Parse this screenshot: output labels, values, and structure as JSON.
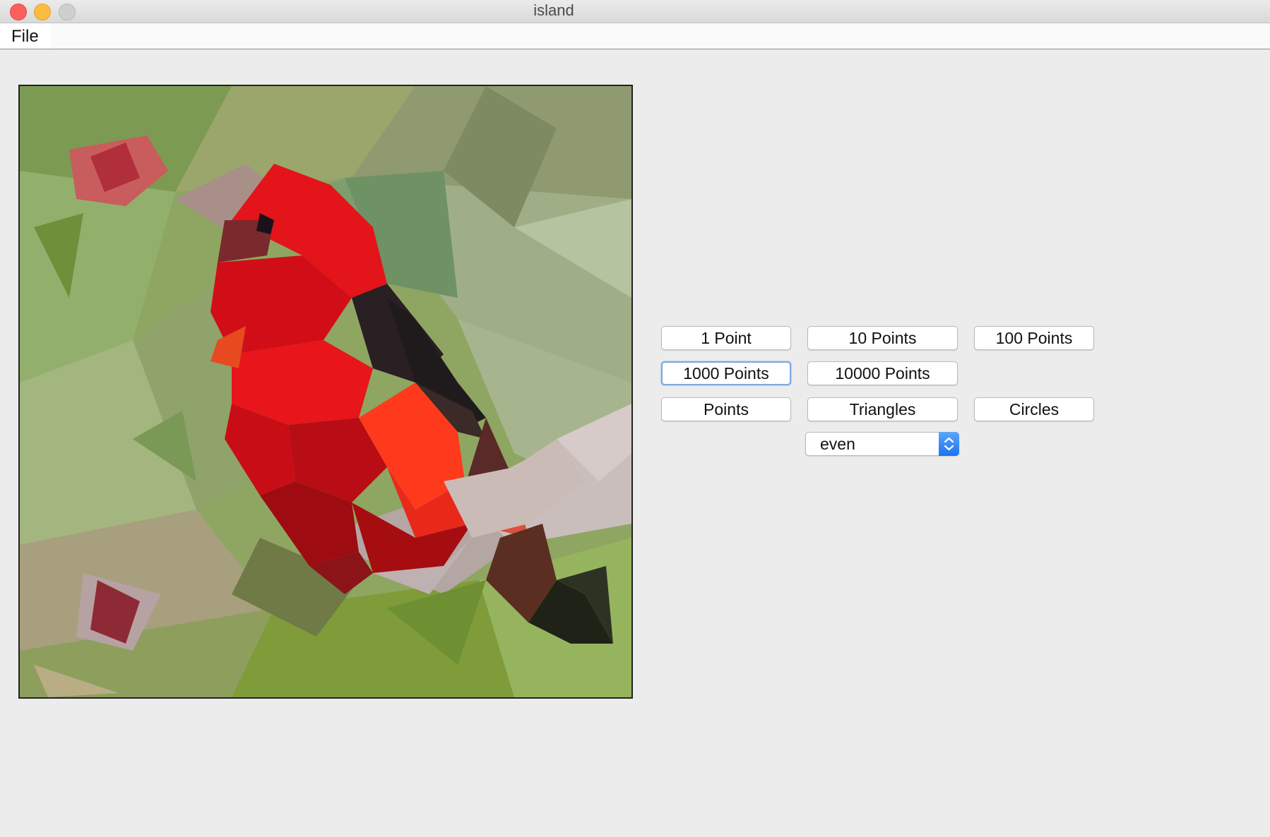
{
  "window": {
    "title": "island",
    "controls": [
      "close-icon",
      "minimize-icon",
      "zoom-icon"
    ]
  },
  "menubar": {
    "file_label": "File"
  },
  "canvas": {
    "description_colors": {
      "background_green": "#8ea662",
      "bird_red": "#e3141a",
      "bird_dark_red": "#9e0c12",
      "black_wing": "#231c20",
      "branch_gray": "#b8aba6"
    }
  },
  "buttons": {
    "one_point": "1 Point",
    "ten_points": "10 Points",
    "hundred_points": "100 Points",
    "thousand_points": "1000 Points",
    "ten_thousand_points": "10000 Points",
    "points": "Points",
    "triangles": "Triangles",
    "circles": "Circles"
  },
  "distribution_select": {
    "value": "even"
  },
  "colors": {
    "window_bg": "#ececec",
    "accent_blue": "#1c74ef"
  }
}
